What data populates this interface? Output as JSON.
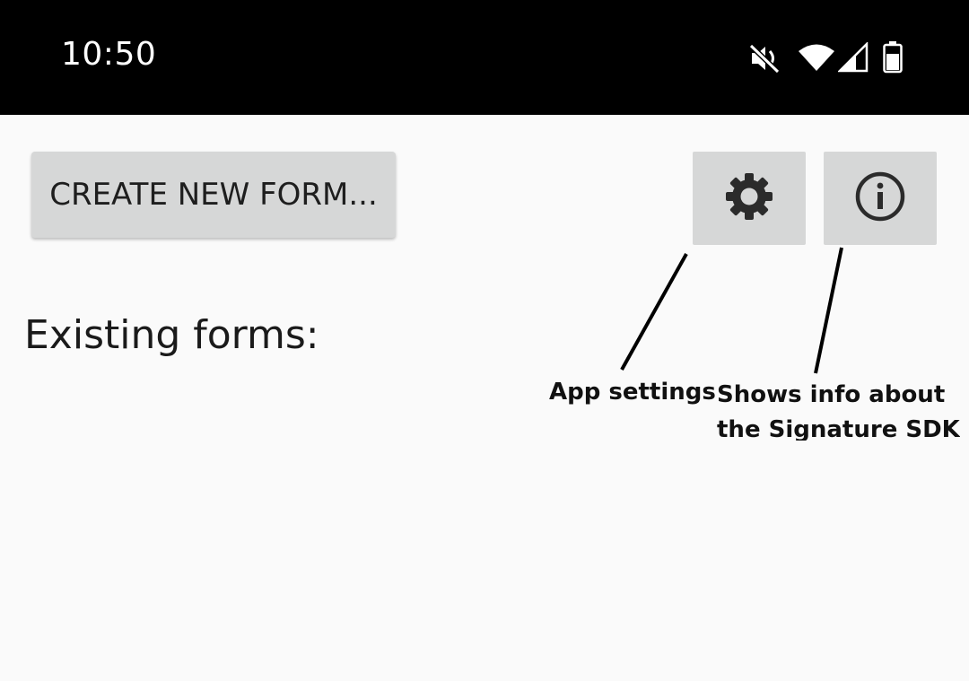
{
  "status_bar": {
    "time": "10:50",
    "icons": [
      "mute-icon",
      "wifi-icon",
      "signal-icon",
      "battery-icon"
    ]
  },
  "toolbar": {
    "create_label": "CREATE NEW FORM...",
    "settings_icon": "gear-icon",
    "info_icon": "info-icon"
  },
  "main": {
    "heading": "Existing forms:"
  },
  "annotations": {
    "settings": "App settings",
    "info_line1": "Shows info about",
    "info_line2": "the Signature SDK"
  },
  "colors": {
    "status_bar": "#000000",
    "background": "#fafafa",
    "button": "#d6d7d7",
    "icon": "#2b2b2b"
  }
}
